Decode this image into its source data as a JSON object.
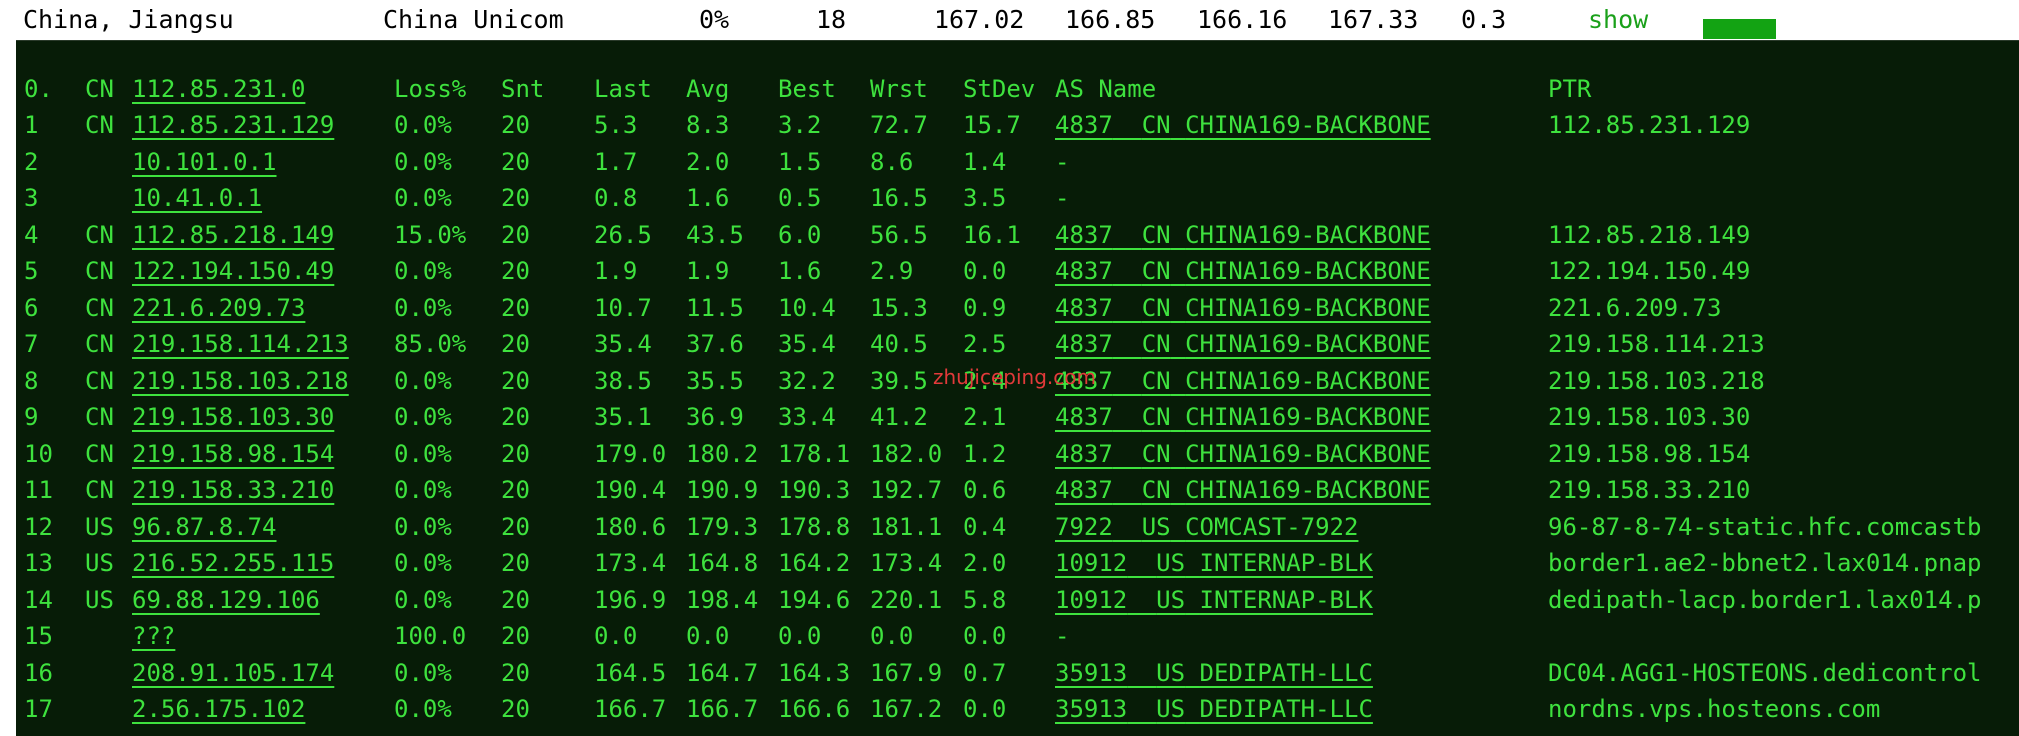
{
  "summary": {
    "location": "China, Jiangsu",
    "isp": "China Unicom",
    "loss": "0%",
    "sent": "18",
    "last": "167.02",
    "avg": "166.85",
    "best": "166.16",
    "worst": "167.33",
    "stdev": "0.3",
    "show_label": "show"
  },
  "colors": {
    "accent": "#3ee23e",
    "background": "#071c07",
    "bar": "#13a313",
    "watermark": "#e23a3a"
  },
  "watermark": "zhujiceping.com",
  "columns": {
    "hop": "0.",
    "cc": "CN",
    "host": "112.85.231.0",
    "loss": "Loss%",
    "snt": "Snt",
    "last": "Last",
    "avg": "Avg",
    "best": "Best",
    "wrst": "Wrst",
    "stdev": "StDev",
    "asname": "AS Name",
    "ptr": "PTR"
  },
  "rows": [
    {
      "hop": "1",
      "cc": "CN",
      "host": "112.85.231.129",
      "loss": "0.0%",
      "snt": "20",
      "last": "5.3",
      "avg": "8.3",
      "best": "3.2",
      "wrst": "72.7",
      "stdev": "15.7",
      "asn": "4837",
      "ascc": "CN",
      "asname": "CHINA169-BACKBONE",
      "ptr": "112.85.231.129"
    },
    {
      "hop": "2",
      "cc": "",
      "host": "10.101.0.1",
      "loss": "0.0%",
      "snt": "20",
      "last": "1.7",
      "avg": "2.0",
      "best": "1.5",
      "wrst": "8.6",
      "stdev": "1.4",
      "asn": "-",
      "ascc": "",
      "asname": "",
      "ptr": ""
    },
    {
      "hop": "3",
      "cc": "",
      "host": "10.41.0.1",
      "loss": "0.0%",
      "snt": "20",
      "last": "0.8",
      "avg": "1.6",
      "best": "0.5",
      "wrst": "16.5",
      "stdev": "3.5",
      "asn": "-",
      "ascc": "",
      "asname": "",
      "ptr": ""
    },
    {
      "hop": "4",
      "cc": "CN",
      "host": "112.85.218.149",
      "loss": "15.0%",
      "snt": "20",
      "last": "26.5",
      "avg": "43.5",
      "best": "6.0",
      "wrst": "56.5",
      "stdev": "16.1",
      "asn": "4837",
      "ascc": "CN",
      "asname": "CHINA169-BACKBONE",
      "ptr": "112.85.218.149"
    },
    {
      "hop": "5",
      "cc": "CN",
      "host": "122.194.150.49",
      "loss": "0.0%",
      "snt": "20",
      "last": "1.9",
      "avg": "1.9",
      "best": "1.6",
      "wrst": "2.9",
      "stdev": "0.0",
      "asn": "4837",
      "ascc": "CN",
      "asname": "CHINA169-BACKBONE",
      "ptr": "122.194.150.49"
    },
    {
      "hop": "6",
      "cc": "CN",
      "host": "221.6.209.73",
      "loss": "0.0%",
      "snt": "20",
      "last": "10.7",
      "avg": "11.5",
      "best": "10.4",
      "wrst": "15.3",
      "stdev": "0.9",
      "asn": "4837",
      "ascc": "CN",
      "asname": "CHINA169-BACKBONE",
      "ptr": "221.6.209.73"
    },
    {
      "hop": "7",
      "cc": "CN",
      "host": "219.158.114.213",
      "loss": "85.0%",
      "snt": "20",
      "last": "35.4",
      "avg": "37.6",
      "best": "35.4",
      "wrst": "40.5",
      "stdev": "2.5",
      "asn": "4837",
      "ascc": "CN",
      "asname": "CHINA169-BACKBONE",
      "ptr": "219.158.114.213"
    },
    {
      "hop": "8",
      "cc": "CN",
      "host": "219.158.103.218",
      "loss": "0.0%",
      "snt": "20",
      "last": "38.5",
      "avg": "35.5",
      "best": "32.2",
      "wrst": "39.5",
      "stdev": "2.4",
      "asn": "4837",
      "ascc": "CN",
      "asname": "CHINA169-BACKBONE",
      "ptr": "219.158.103.218"
    },
    {
      "hop": "9",
      "cc": "CN",
      "host": "219.158.103.30",
      "loss": "0.0%",
      "snt": "20",
      "last": "35.1",
      "avg": "36.9",
      "best": "33.4",
      "wrst": "41.2",
      "stdev": "2.1",
      "asn": "4837",
      "ascc": "CN",
      "asname": "CHINA169-BACKBONE",
      "ptr": "219.158.103.30"
    },
    {
      "hop": "10",
      "cc": "CN",
      "host": "219.158.98.154",
      "loss": "0.0%",
      "snt": "20",
      "last": "179.0",
      "avg": "180.2",
      "best": "178.1",
      "wrst": "182.0",
      "stdev": "1.2",
      "asn": "4837",
      "ascc": "CN",
      "asname": "CHINA169-BACKBONE",
      "ptr": "219.158.98.154"
    },
    {
      "hop": "11",
      "cc": "CN",
      "host": "219.158.33.210",
      "loss": "0.0%",
      "snt": "20",
      "last": "190.4",
      "avg": "190.9",
      "best": "190.3",
      "wrst": "192.7",
      "stdev": "0.6",
      "asn": "4837",
      "ascc": "CN",
      "asname": "CHINA169-BACKBONE",
      "ptr": "219.158.33.210"
    },
    {
      "hop": "12",
      "cc": "US",
      "host": "96.87.8.74",
      "loss": "0.0%",
      "snt": "20",
      "last": "180.6",
      "avg": "179.3",
      "best": "178.8",
      "wrst": "181.1",
      "stdev": "0.4",
      "asn": "7922",
      "ascc": "US",
      "asname": "COMCAST-7922",
      "ptr": "96-87-8-74-static.hfc.comcastb"
    },
    {
      "hop": "13",
      "cc": "US",
      "host": "216.52.255.115",
      "loss": "0.0%",
      "snt": "20",
      "last": "173.4",
      "avg": "164.8",
      "best": "164.2",
      "wrst": "173.4",
      "stdev": "2.0",
      "asn": "10912",
      "ascc": "US",
      "asname": "INTERNAP-BLK",
      "ptr": "border1.ae2-bbnet2.lax014.pnap"
    },
    {
      "hop": "14",
      "cc": "US",
      "host": "69.88.129.106",
      "loss": "0.0%",
      "snt": "20",
      "last": "196.9",
      "avg": "198.4",
      "best": "194.6",
      "wrst": "220.1",
      "stdev": "5.8",
      "asn": "10912",
      "ascc": "US",
      "asname": "INTERNAP-BLK",
      "ptr": "dedipath-lacp.border1.lax014.p"
    },
    {
      "hop": "15",
      "cc": "",
      "host": "???",
      "loss": "100.0",
      "snt": "20",
      "last": "0.0",
      "avg": "0.0",
      "best": "0.0",
      "wrst": "0.0",
      "stdev": "0.0",
      "asn": "-",
      "ascc": "",
      "asname": "",
      "ptr": ""
    },
    {
      "hop": "16",
      "cc": "",
      "host": "208.91.105.174",
      "loss": "0.0%",
      "snt": "20",
      "last": "164.5",
      "avg": "164.7",
      "best": "164.3",
      "wrst": "167.9",
      "stdev": "0.7",
      "asn": "35913",
      "ascc": "US",
      "asname": "DEDIPATH-LLC",
      "ptr": "DC04.AGG1-HOSTEONS.dedicontrol"
    },
    {
      "hop": "17",
      "cc": "",
      "host": "2.56.175.102",
      "loss": "0.0%",
      "snt": "20",
      "last": "166.7",
      "avg": "166.7",
      "best": "166.6",
      "wrst": "167.2",
      "stdev": "0.0",
      "asn": "35913",
      "ascc": "US",
      "asname": "DEDIPATH-LLC",
      "ptr": "nordns.vps.hosteons.com"
    }
  ]
}
